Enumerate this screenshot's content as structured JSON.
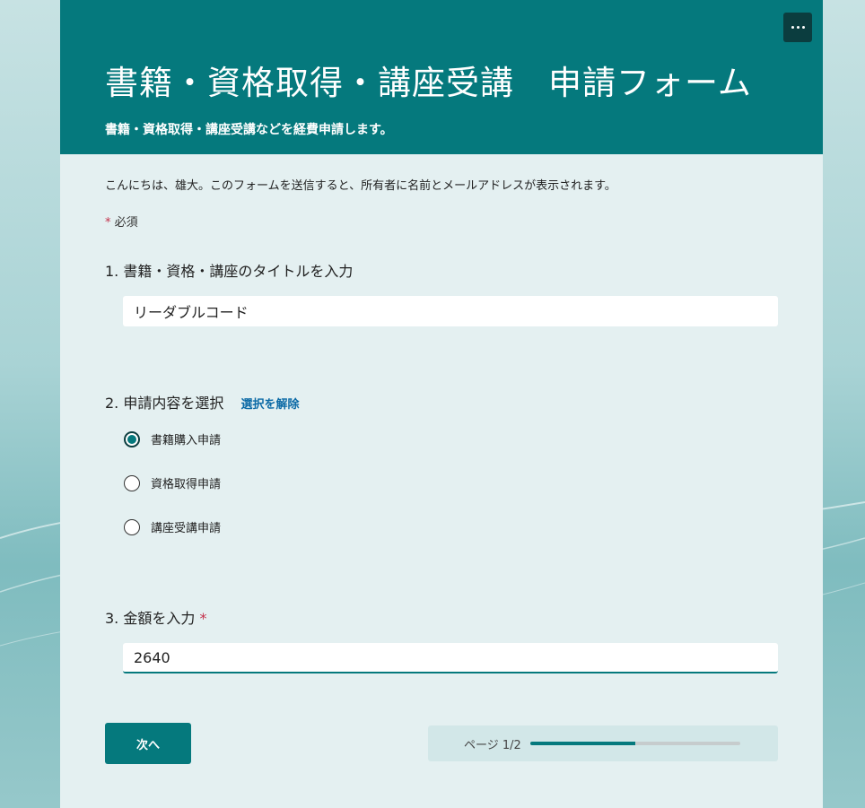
{
  "colors": {
    "accent": "#05797d",
    "required": "#c4314b",
    "link": "#0b6aa6"
  },
  "header": {
    "title": "書籍・資格取得・講座受講　申請フォーム",
    "subtitle": "書籍・資格取得・講座受講などを経費申請します。",
    "more_icon": "more-horizontal-icon"
  },
  "intro": {
    "text": "こんにちは、雄大。このフォームを送信すると、所有者に名前とメールアドレスが表示されます。",
    "required_star": "*",
    "required_label": "必須"
  },
  "questions": [
    {
      "title": "1. 書籍・資格・講座のタイトルを入力",
      "value": "リーダブルコード"
    },
    {
      "title": "2. 申請内容を選択",
      "clear_label": "選択を解除",
      "options": [
        {
          "label": "書籍購入申請",
          "checked": true
        },
        {
          "label": "資格取得申請",
          "checked": false
        },
        {
          "label": "講座受講申請",
          "checked": false
        }
      ]
    },
    {
      "title": "3. 金額を入力",
      "required_star": "*",
      "value": "2640"
    }
  ],
  "footer": {
    "next_label": "次へ",
    "page_label": "ページ 1/2",
    "progress_fraction": 0.5
  }
}
